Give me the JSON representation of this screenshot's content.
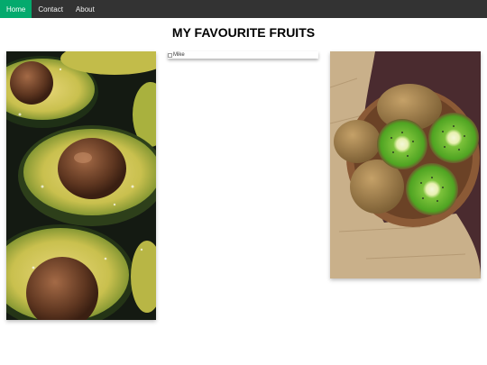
{
  "nav": {
    "items": [
      {
        "label": "Home",
        "active": true
      },
      {
        "label": "Contact",
        "active": false
      },
      {
        "label": "About",
        "active": false
      }
    ],
    "active_color": "#04AA6D",
    "bar_color": "#333333"
  },
  "page": {
    "title": "MY FAVOURITE FRUITS"
  },
  "gallery": {
    "cards": [
      {
        "image": "avocado-halves-photo"
      },
      {
        "image": "broken-image",
        "alt": "Mike"
      },
      {
        "image": "kiwi-bowl-photo"
      }
    ]
  }
}
